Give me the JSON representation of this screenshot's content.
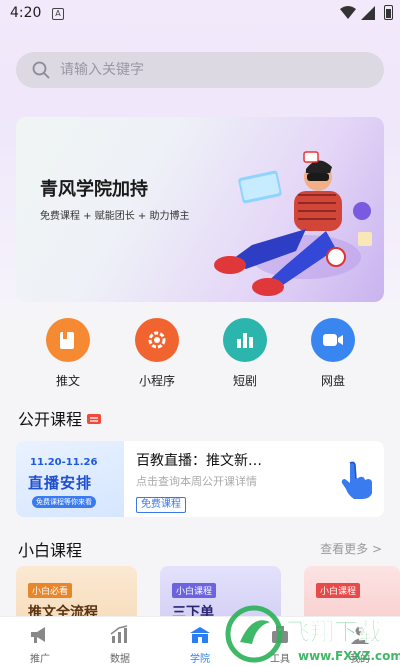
{
  "status_bar": {
    "time": "4:20"
  },
  "search": {
    "placeholder": "请输入关键字"
  },
  "banner": {
    "title": "青风学院加持",
    "subtitle": "免费课程 + 赋能团长 + 助力博主"
  },
  "quick_menu": [
    {
      "label": "推文",
      "icon": "book-icon",
      "color": "#f58a32"
    },
    {
      "label": "小程序",
      "icon": "gear-icon",
      "color": "#f2642f"
    },
    {
      "label": "短剧",
      "icon": "bar-chart-icon",
      "color": "#2bb5ad"
    },
    {
      "label": "网盘",
      "icon": "video-camera-icon",
      "color": "#3a86f0"
    }
  ],
  "open_course": {
    "section_title": "公开课程",
    "card": {
      "thumb_date": "11.20-11.26",
      "thumb_title": "直播安排",
      "thumb_note": "免费课程等你来看",
      "title": "百教直播：推文新…",
      "description": "点击查询本周公开课详情",
      "tag": "免费课程"
    }
  },
  "beginner_course": {
    "section_title": "小白课程",
    "more": "查看更多 >",
    "cards": [
      {
        "tag": "小白必看",
        "title": "推文全流程"
      },
      {
        "tag": "小白课程",
        "title": "三下单"
      },
      {
        "tag": "小白课程",
        "title": ""
      }
    ]
  },
  "tab_bar": [
    {
      "label": "推广",
      "icon": "megaphone-icon",
      "active": false
    },
    {
      "label": "数据",
      "icon": "chart-icon",
      "active": false
    },
    {
      "label": "学院",
      "icon": "school-icon",
      "active": true
    },
    {
      "label": "工具",
      "icon": "tools-icon",
      "active": false
    },
    {
      "label": "我的",
      "icon": "user-icon",
      "active": false
    }
  ],
  "watermark": {
    "text": "飞翔下载",
    "url": "www.FXXZ.com"
  },
  "colors": {
    "accent": "#2c7ff2",
    "tag_blue": "#3a78e8"
  }
}
